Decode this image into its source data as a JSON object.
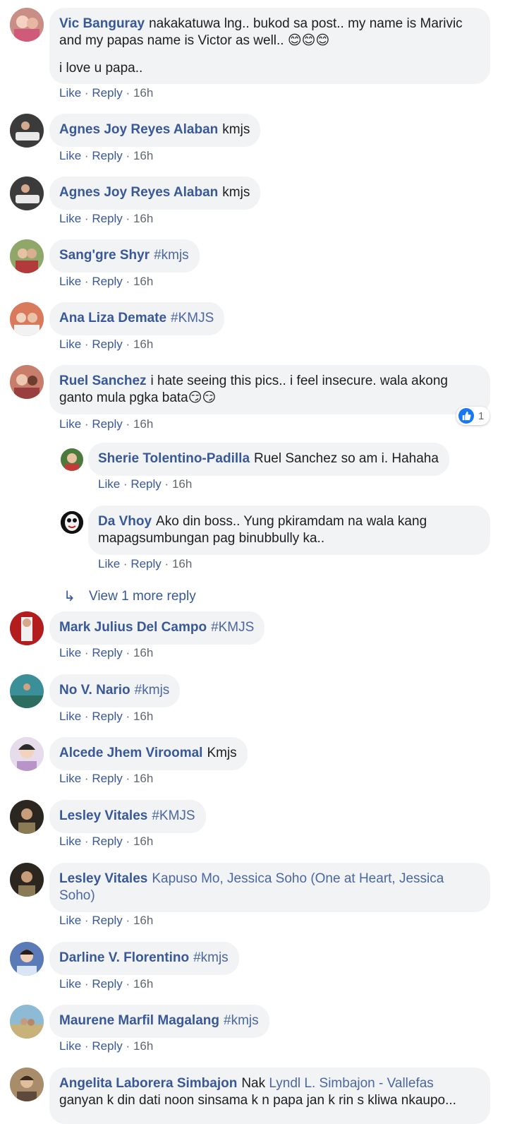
{
  "actions": {
    "like": "Like",
    "reply": "Reply",
    "sep": "·"
  },
  "colors": {
    "link": "#385898",
    "bubble": "#f2f3f5",
    "meta": "#606770",
    "like_blue": "#1877f2"
  },
  "comments": [
    {
      "author": "Vic Banguray",
      "text": "nakakatuwa lng.. bukod sa post.. my name is Marivic and my papas name is Victor as well.. 😊😊😊",
      "text2": "i love u papa..",
      "time": "16h",
      "avatar_icon": "user-photo-icon"
    },
    {
      "author": "Agnes Joy Reyes Alaban",
      "text": "kmjs",
      "time": "16h",
      "avatar_icon": "user-photo-icon"
    },
    {
      "author": "Agnes Joy Reyes Alaban",
      "text": "kmjs",
      "time": "16h",
      "avatar_icon": "user-photo-icon"
    },
    {
      "author": "Sang'gre Shyr",
      "text": "#kmjs",
      "time": "16h",
      "avatar_icon": "user-photo-icon"
    },
    {
      "author": "Ana Liza Demate",
      "text": "#KMJS",
      "time": "16h",
      "avatar_icon": "user-photo-icon"
    },
    {
      "author": "Ruel Sanchez",
      "text": "i hate seeing this pics.. i feel insecure. wala akong ganto mula pgka bata😏😏",
      "time": "16h",
      "reaction_count": "1",
      "reaction_icon": "like-reaction-icon",
      "avatar_icon": "user-photo-icon"
    },
    {
      "author": "Mark Julius Del Campo",
      "text": "#KMJS",
      "time": "16h",
      "avatar_icon": "user-photo-icon"
    },
    {
      "author": "No V. Nario",
      "text": "#kmjs",
      "time": "16h",
      "avatar_icon": "user-photo-icon"
    },
    {
      "author": "Alcede Jhem Viroomal",
      "text": "Kmjs",
      "time": "16h",
      "avatar_icon": "user-photo-icon"
    },
    {
      "author": "Lesley Vitales",
      "text": "#KMJS",
      "time": "16h",
      "avatar_icon": "user-photo-icon"
    },
    {
      "author": "Lesley Vitales",
      "text": "Kapuso Mo, Jessica Soho (One at Heart, Jessica Soho)",
      "time": "16h",
      "avatar_icon": "user-photo-icon"
    },
    {
      "author": "Darline V. Florentino",
      "text": "#kmjs",
      "time": "16h",
      "avatar_icon": "user-photo-icon"
    },
    {
      "author": "Maurene Marfil Magalang",
      "text": "#kmjs",
      "time": "16h",
      "avatar_icon": "user-photo-icon"
    },
    {
      "author": "Angelita Laborera Simbajon",
      "text_pre": "Nak",
      "mention": "Lyndl L. Simbajon - Vallefas",
      "text_post": "ganyan k din dati noon sinsama k n papa jan k rin s kliwa nkaupo...",
      "avatar_icon": "user-photo-icon"
    }
  ],
  "replies": [
    {
      "author": "Sherie Tolentino-Padilla",
      "text": "Ruel Sanchez so am i. Hahaha",
      "time": "16h",
      "avatar_icon": "user-photo-icon"
    },
    {
      "author": "Da Vhoy",
      "text": "Ako din boss.. Yung pkiramdam na wala kang mapagsumbungan pag binubbully ka..",
      "time": "16h",
      "avatar_icon": "mask-avatar-icon"
    }
  ],
  "view_more": {
    "label": "View 1 more reply",
    "icon": "reply-arrow-icon"
  }
}
